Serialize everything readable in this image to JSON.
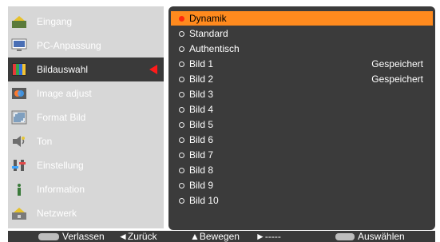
{
  "sidebar": {
    "items": [
      {
        "label": "Eingang",
        "icon": "input-icon"
      },
      {
        "label": "PC-Anpassung",
        "icon": "pc-monitor-icon"
      },
      {
        "label": "Bildauswahl",
        "icon": "image-select-icon"
      },
      {
        "label": "Image adjust",
        "icon": "image-adjust-icon"
      },
      {
        "label": "Format Bild",
        "icon": "format-icon"
      },
      {
        "label": "Ton",
        "icon": "speaker-icon"
      },
      {
        "label": "Einstellung",
        "icon": "settings-icon"
      },
      {
        "label": "Information",
        "icon": "info-icon"
      },
      {
        "label": "Netzwerk",
        "icon": "network-icon"
      }
    ]
  },
  "panel": {
    "options": [
      {
        "label": "Dynamik",
        "status": ""
      },
      {
        "label": "Standard",
        "status": ""
      },
      {
        "label": "Authentisch",
        "status": ""
      },
      {
        "label": "Bild 1",
        "status": "Gespeichert"
      },
      {
        "label": "Bild 2",
        "status": "Gespeichert"
      },
      {
        "label": "Bild 3",
        "status": ""
      },
      {
        "label": "Bild 4",
        "status": ""
      },
      {
        "label": "Bild 5",
        "status": ""
      },
      {
        "label": "Bild 6",
        "status": ""
      },
      {
        "label": "Bild 7",
        "status": ""
      },
      {
        "label": "Bild 8",
        "status": ""
      },
      {
        "label": "Bild 9",
        "status": ""
      },
      {
        "label": "Bild 10",
        "status": ""
      }
    ]
  },
  "footer": {
    "leave": "Verlassen",
    "back": "◄Zurück",
    "move": "▲Bewegen",
    "next": "►-----",
    "select": "Auswählen"
  }
}
